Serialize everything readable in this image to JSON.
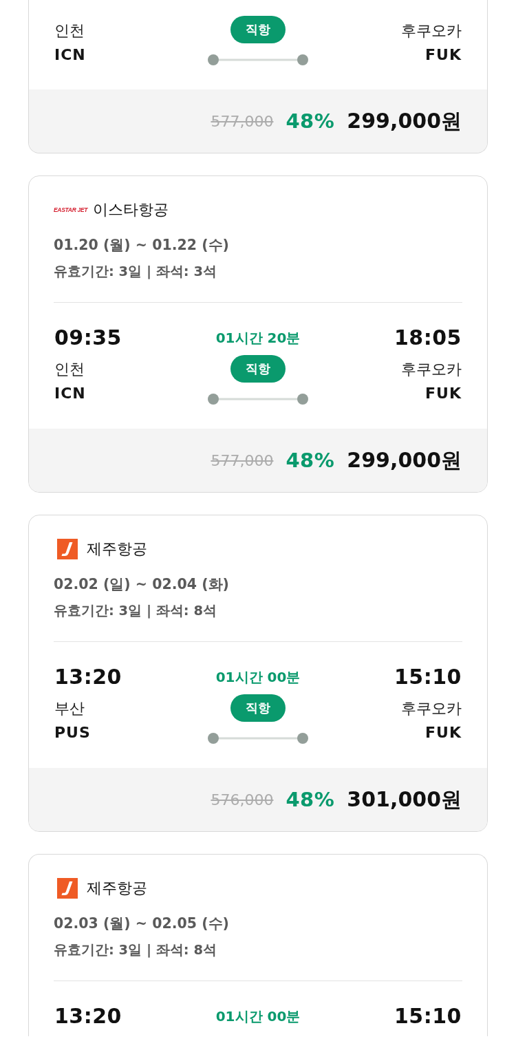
{
  "flights": [
    {
      "departure": {
        "city": "인천",
        "code": "ICN"
      },
      "stop_label": "직항",
      "arrival": {
        "city": "후쿠오카",
        "code": "FUK"
      },
      "original_price": "577,000",
      "discount": "48%",
      "price": "299,000원"
    },
    {
      "airline": {
        "name": "이스타항공",
        "logo": {
          "kind": "wordmark",
          "text": "EASTAR JET"
        }
      },
      "dates": "01.20 (월) ~ 01.22 (수)",
      "validity": "유효기간: 3일 | 좌석: 3석",
      "departure": {
        "time": "09:35",
        "city": "인천",
        "code": "ICN"
      },
      "duration": "01시간 20분",
      "stop_label": "직항",
      "arrival": {
        "time": "18:05",
        "city": "후쿠오카",
        "code": "FUK"
      },
      "original_price": "577,000",
      "discount": "48%",
      "price": "299,000원"
    },
    {
      "airline": {
        "name": "제주항공",
        "logo": {
          "kind": "badge"
        }
      },
      "dates": "02.02 (일) ~ 02.04 (화)",
      "validity": "유효기간: 3일 | 좌석: 8석",
      "departure": {
        "time": "13:20",
        "city": "부산",
        "code": "PUS"
      },
      "duration": "01시간 00분",
      "stop_label": "직항",
      "arrival": {
        "time": "15:10",
        "city": "후쿠오카",
        "code": "FUK"
      },
      "original_price": "576,000",
      "discount": "48%",
      "price": "301,000원"
    },
    {
      "airline": {
        "name": "제주항공",
        "logo": {
          "kind": "badge"
        }
      },
      "dates": "02.03 (월) ~ 02.05 (수)",
      "validity": "유효기간: 3일 | 좌석: 8석",
      "departure": {
        "time": "13:20"
      },
      "duration": "01시간 00분",
      "arrival": {
        "time": "15:10"
      }
    }
  ]
}
